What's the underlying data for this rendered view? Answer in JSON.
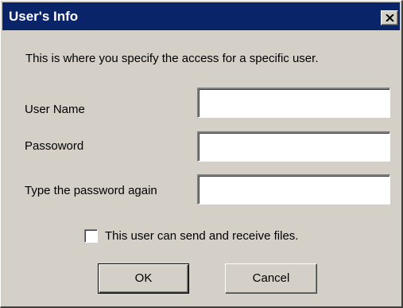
{
  "window": {
    "title": "User's Info",
    "close_icon": "close-x-icon"
  },
  "intro_text": "This is where you specify the access for a specific user.",
  "fields": [
    {
      "label": "User Name",
      "value": "",
      "placeholder": ""
    },
    {
      "label": "Passoword",
      "value": "",
      "placeholder": ""
    },
    {
      "label": "Type the password again",
      "value": "",
      "placeholder": ""
    }
  ],
  "checkbox": {
    "label": "This user can send and receive files.",
    "checked": false
  },
  "buttons": {
    "ok_label": "OK",
    "cancel_label": "Cancel"
  },
  "colors": {
    "titlebar": "#0a246a",
    "face": "#d4d0c8"
  }
}
